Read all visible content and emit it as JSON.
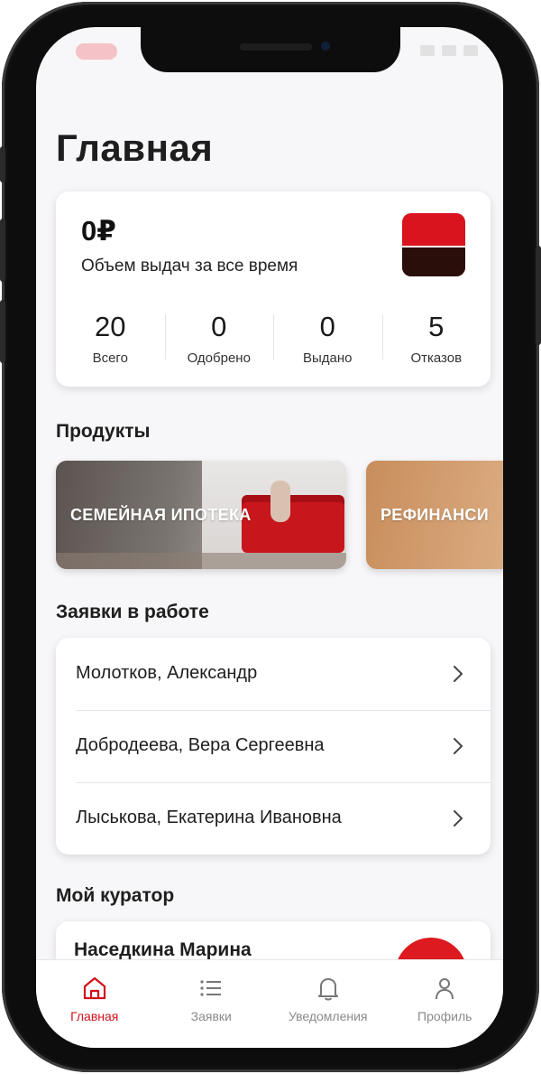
{
  "header": {
    "title": "Главная"
  },
  "stats": {
    "amount": "0₽",
    "amount_caption": "Объем выдач за все время",
    "items": [
      {
        "value": "20",
        "label": "Всего"
      },
      {
        "value": "0",
        "label": "Одобрено"
      },
      {
        "value": "0",
        "label": "Выдано"
      },
      {
        "value": "5",
        "label": "Отказов"
      }
    ]
  },
  "products": {
    "title": "Продукты",
    "items": [
      {
        "label": "СЕМЕЙНАЯ ИПОТЕКА"
      },
      {
        "label": "РЕФИНАНСИ"
      }
    ]
  },
  "requests": {
    "title": "Заявки в работе",
    "items": [
      {
        "name": "Молотков, Александр"
      },
      {
        "name": "Добродеева, Вера Сергеевна"
      },
      {
        "name": "Лыськова, Екатерина Ивановна"
      }
    ]
  },
  "curator": {
    "title": "Мой куратор",
    "name": "Наседкина Марина"
  },
  "tabbar": {
    "items": [
      {
        "label": "Главная",
        "icon": "home-icon",
        "active": true
      },
      {
        "label": "Заявки",
        "icon": "list-icon",
        "active": false
      },
      {
        "label": "Уведомления",
        "icon": "bell-icon",
        "active": false
      },
      {
        "label": "Профиль",
        "icon": "user-icon",
        "active": false
      }
    ]
  },
  "colors": {
    "accent": "#d0121b",
    "background": "#f7f6f8",
    "inactive_tab": "#8a8a8a"
  }
}
